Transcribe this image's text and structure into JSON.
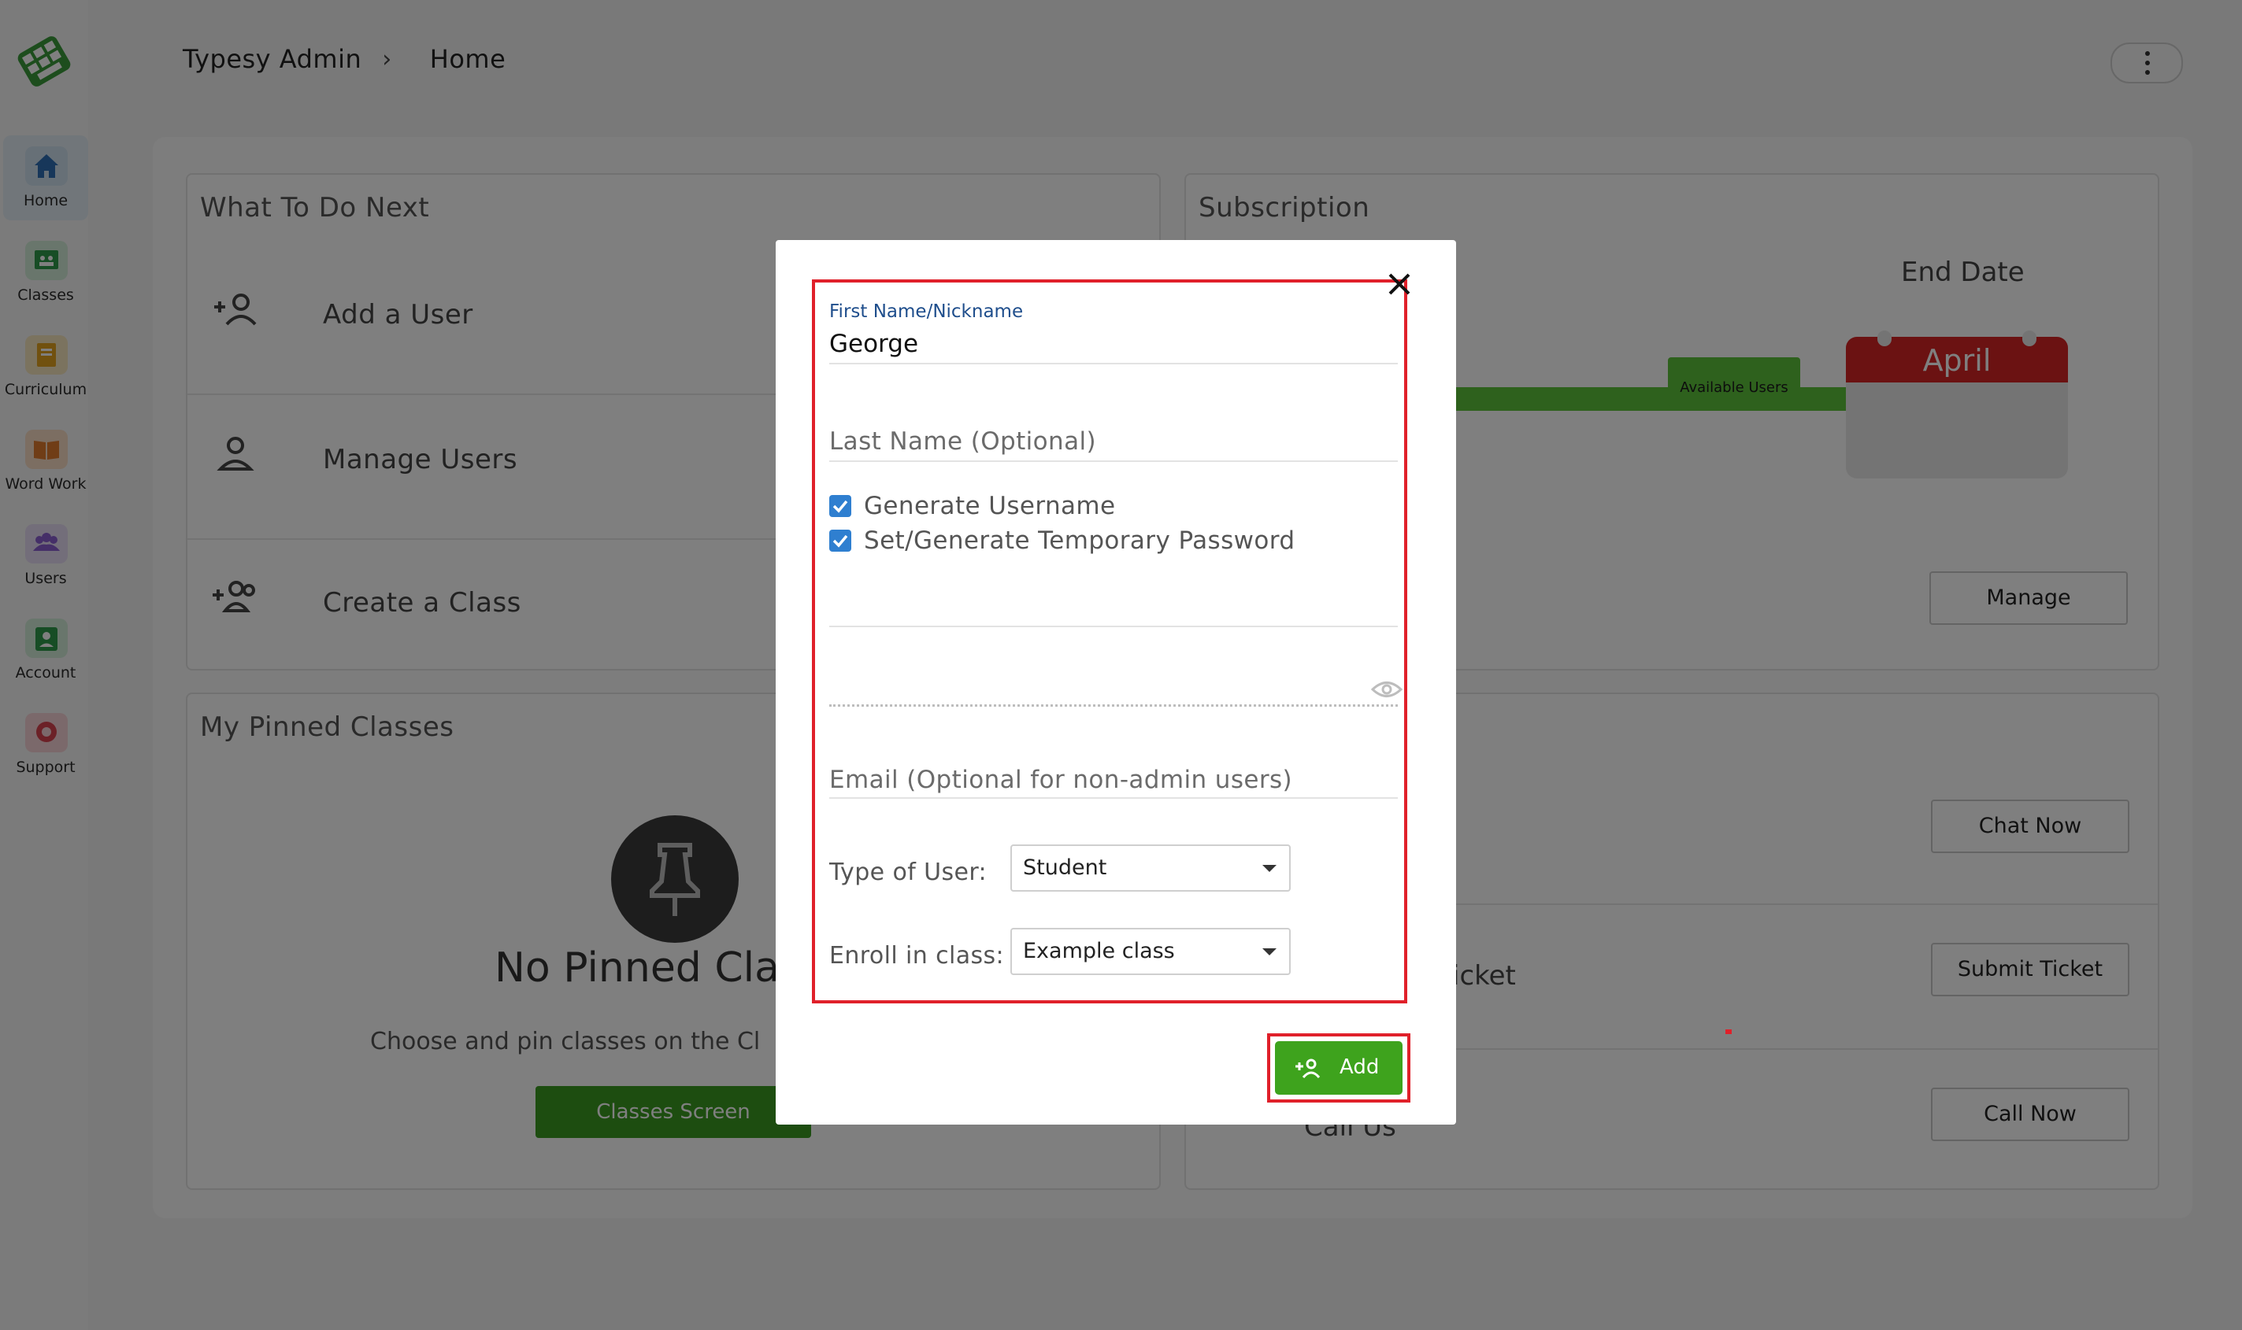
{
  "sidebar": {
    "items": [
      {
        "label": "Home",
        "icon": "home-icon",
        "color": "#2f6fb5"
      },
      {
        "label": "Classes",
        "icon": "classes-icon",
        "color": "#2e9a4a"
      },
      {
        "label": "Curriculum",
        "icon": "curriculum-icon",
        "color": "#e2a21f"
      },
      {
        "label": "Word Work",
        "icon": "word-work-icon",
        "color": "#e07b2c"
      },
      {
        "label": "Users",
        "icon": "users-icon",
        "color": "#8b5fd0"
      },
      {
        "label": "Account",
        "icon": "account-icon",
        "color": "#2e9a4a"
      },
      {
        "label": "Support",
        "icon": "support-icon",
        "color": "#d9434f"
      }
    ]
  },
  "header": {
    "breadcrumb": [
      "Typesy Admin",
      "Home"
    ]
  },
  "what_to_do_next": {
    "title": "What To Do Next",
    "items": [
      "Add a User",
      "Manage Users",
      "Create a Class"
    ]
  },
  "subscription": {
    "title": "Subscription",
    "end_date_label": "End Date",
    "end_month": "April",
    "available_users_label": "Available Users",
    "manage_label": "Manage"
  },
  "pinned": {
    "title": "My Pinned Classes",
    "empty_title": "No Pinned Clas",
    "empty_sub": "Choose and pin classes on the Cl",
    "classes_button": "Classes Screen"
  },
  "support": {
    "chat_label": "Chat Now",
    "ticket_partial": "icket",
    "ticket_label": "Submit Ticket",
    "call_partial": "Call Us",
    "call_label": "Call Now"
  },
  "modal": {
    "first_name_label": "First Name/Nickname",
    "first_name_value": "George",
    "last_name_placeholder": "Last Name (Optional)",
    "generate_username_label": "Generate Username",
    "generate_password_label": "Set/Generate Temporary Password",
    "email_placeholder": "Email (Optional for non-admin users)",
    "type_label": "Type of User:",
    "type_value": "Student",
    "enroll_label": "Enroll in class:",
    "enroll_value": "Example class",
    "add_label": "Add"
  },
  "colors": {
    "accent_green": "#3ea31d",
    "highlight_red": "#e0202a",
    "checkbox_blue": "#2f7fd0"
  }
}
